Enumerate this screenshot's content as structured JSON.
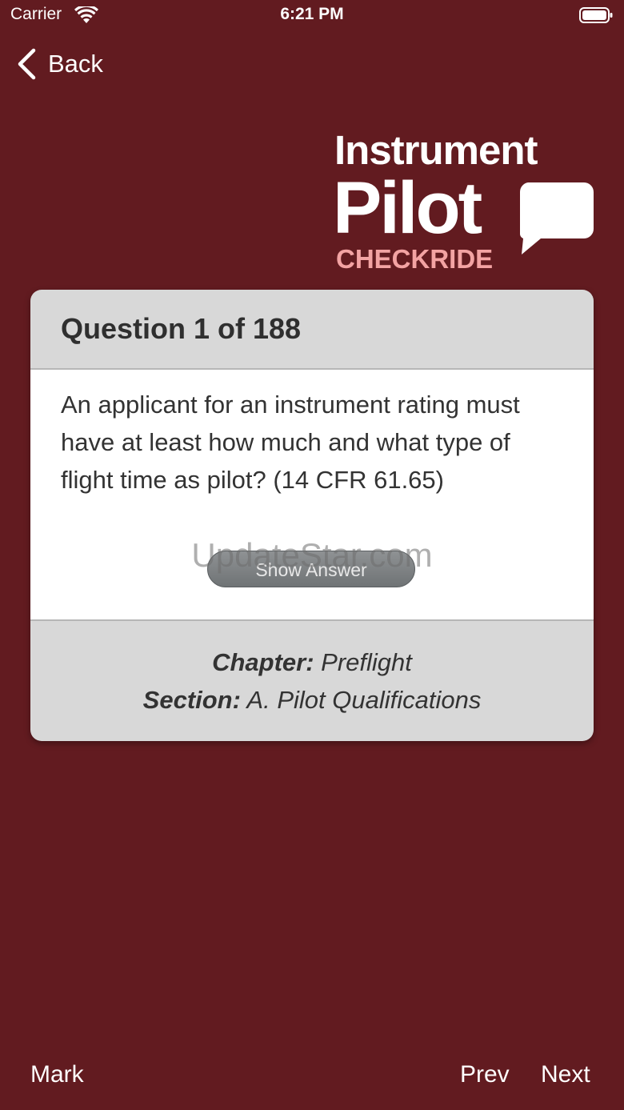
{
  "status_bar": {
    "carrier": "Carrier",
    "time": "6:21 PM"
  },
  "nav": {
    "back_label": "Back"
  },
  "logo": {
    "line1": "Instrument",
    "line2": "Pilot",
    "line3": "CHECKRIDE"
  },
  "card": {
    "title": "Question 1 of 188",
    "question": "An applicant for an instrument rating must have at least how much and what type of flight time as pilot? (14 CFR 61.65)",
    "show_answer_label": "Show Answer",
    "watermark": "UpdateStar.com",
    "chapter_label": "Chapter:",
    "chapter_value": "Preflight",
    "section_label": "Section:",
    "section_value": "A. Pilot Qualifications"
  },
  "toolbar": {
    "mark_label": "Mark",
    "prev_label": "Prev",
    "next_label": "Next"
  },
  "colors": {
    "background": "#621b20",
    "logo_accent": "#f3a3a3",
    "card": "#d8d8d8"
  }
}
